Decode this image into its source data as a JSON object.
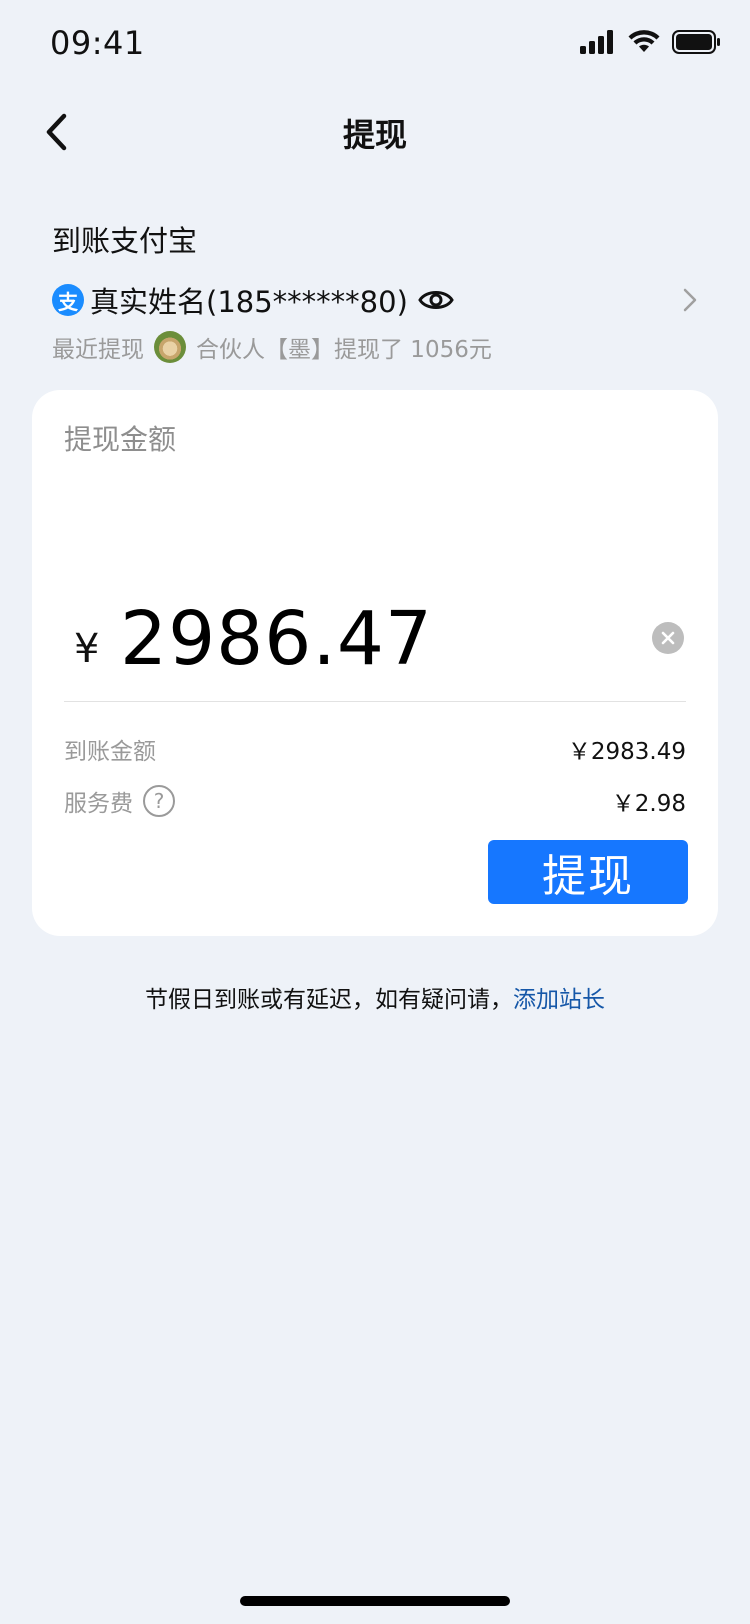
{
  "status_bar": {
    "time": "09:41"
  },
  "nav": {
    "title": "提现"
  },
  "account": {
    "section_label": "到账支付宝",
    "alipay_glyph": "支",
    "account_name": "真实姓名(185******80)",
    "recent_label": "最近提现",
    "recent_text": "合伙人【墨】提现了 1056元"
  },
  "withdraw": {
    "amount_label": "提现金额",
    "currency_symbol": "¥",
    "amount": "2986.47",
    "received_label": "到账金额",
    "received_value": "￥2983.49",
    "fee_label": "服务费",
    "fee_value": "￥2.98",
    "submit_label": "提现"
  },
  "footer": {
    "notice_text": "节假日到账或有延迟，如有疑问请，",
    "notice_link": "添加站长"
  },
  "colors": {
    "background": "#EEF2F8",
    "primary": "#1677FF",
    "link": "#1557A8",
    "alipay": "#1A8CFF"
  }
}
